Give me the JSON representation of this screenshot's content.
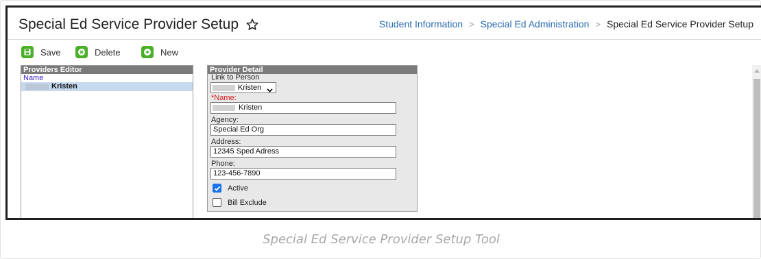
{
  "header": {
    "title": "Special Ed Service Provider Setup",
    "star_icon": "star-outline-icon",
    "breadcrumb": {
      "items": [
        "Student Information",
        "Special Ed Administration"
      ],
      "current": "Special Ed Service Provider Setup",
      "separator": ">"
    }
  },
  "toolbar": {
    "save_label": "Save",
    "delete_label": "Delete",
    "new_label": "New",
    "accent": "#4caf2b"
  },
  "providers_editor": {
    "title": "Providers Editor",
    "column_header": "Name",
    "rows": [
      {
        "name": "Kristen"
      }
    ]
  },
  "provider_detail": {
    "title": "Provider Detail",
    "link_to_person": {
      "label": "Link to Person",
      "selected": "Kristen"
    },
    "name": {
      "label": "*Name:",
      "value": "Kristen"
    },
    "agency": {
      "label": "Agency:",
      "value": "Special Ed Org"
    },
    "address": {
      "label": "Address:",
      "value": "12345 Sped Adress"
    },
    "phone": {
      "label": "Phone:",
      "value": "123-456-7890"
    },
    "active": {
      "label": "Active",
      "checked": true
    },
    "bill_exclude": {
      "label": "Bill Exclude",
      "checked": false
    }
  },
  "caption": "Special Ed Service Provider Setup Tool"
}
